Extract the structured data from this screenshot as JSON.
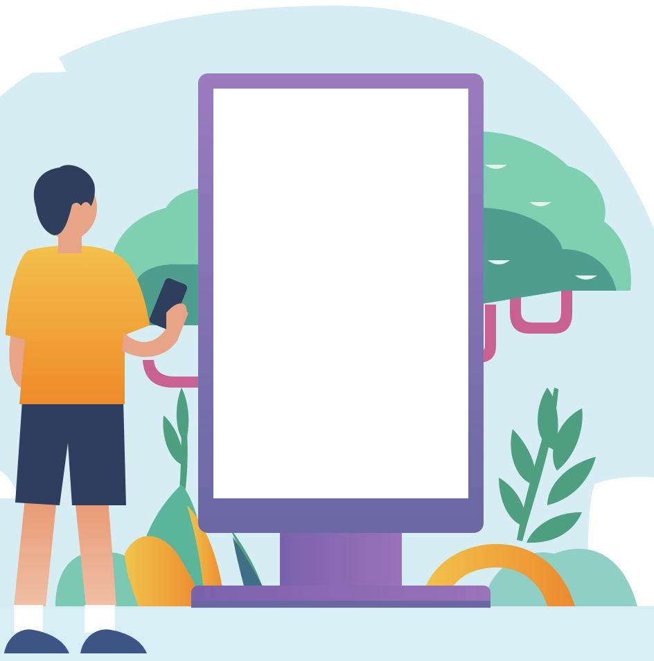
{
  "scene": {
    "subject": "person-looking-at-blank-billboard",
    "billboard_screen_content": "",
    "colors": {
      "sky_blob": "#d6edf4",
      "ground": "#d7eef5",
      "cloud": "#ffffff",
      "billboard_frame": "#8a6db3",
      "billboard_frame_dark": "#6b67a3",
      "billboard_screen": "#ffffff",
      "tree_canopy_light": "#7fcfb1",
      "tree_canopy_dark": "#4f9d8f",
      "tree_branch": "#c96293",
      "leaf_green": "#4e9f7f",
      "bush_yellow": "#f2b53a",
      "bush_orange": "#ec8a2f",
      "shirt": "#f5a233",
      "shorts": "#2d3e5e",
      "hair": "#2e3f5d",
      "skin": "#e7a487",
      "shoes": "#3d5585",
      "socks": "#ffffff",
      "phone": "#2e3f5d"
    },
    "icons": [
      "cloud-icon",
      "tree-icon",
      "billboard-icon",
      "person-icon",
      "smartphone-icon",
      "plant-icon"
    ]
  }
}
